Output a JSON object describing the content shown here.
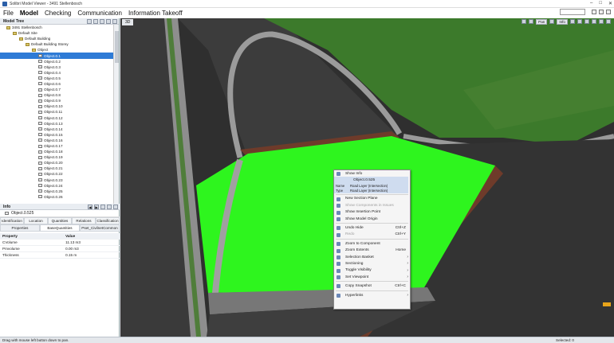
{
  "window": {
    "title": "Solibri Model Viewer - 3491 Stellenbosch",
    "minimize": "–",
    "maximize": "□",
    "close": "✕"
  },
  "menu": [
    "File",
    "Model",
    "Checking",
    "Communication",
    "Information Takeoff"
  ],
  "model_tree": {
    "title": "Model Tree",
    "nodes": [
      {
        "label": "3491 Stellenbosch",
        "indent": 1
      },
      {
        "label": "Default Site",
        "indent": 2
      },
      {
        "label": "Default Building",
        "indent": 3
      },
      {
        "label": "Default Building Storey",
        "indent": 4
      },
      {
        "label": "Object",
        "indent": 5
      },
      {
        "label": "Object.0.1",
        "indent": 6,
        "selected": true
      },
      {
        "label": "Object.0.2",
        "indent": 6
      },
      {
        "label": "Object.0.3",
        "indent": 6
      },
      {
        "label": "Object.0.4",
        "indent": 6
      },
      {
        "label": "Object.0.5",
        "indent": 6
      },
      {
        "label": "Object.0.6",
        "indent": 6
      },
      {
        "label": "Object.0.7",
        "indent": 6
      },
      {
        "label": "Object.0.8",
        "indent": 6
      },
      {
        "label": "Object.0.9",
        "indent": 6
      },
      {
        "label": "Object.0.10",
        "indent": 6
      },
      {
        "label": "Object.0.11",
        "indent": 6
      },
      {
        "label": "Object.0.12",
        "indent": 6
      },
      {
        "label": "Object.0.13",
        "indent": 6
      },
      {
        "label": "Object.0.14",
        "indent": 6
      },
      {
        "label": "Object.0.15",
        "indent": 6
      },
      {
        "label": "Object.0.16",
        "indent": 6
      },
      {
        "label": "Object.0.17",
        "indent": 6
      },
      {
        "label": "Object.0.18",
        "indent": 6
      },
      {
        "label": "Object.0.19",
        "indent": 6
      },
      {
        "label": "Object.0.20",
        "indent": 6
      },
      {
        "label": "Object.0.21",
        "indent": 6
      },
      {
        "label": "Object.0.22",
        "indent": 6
      },
      {
        "label": "Object.0.23",
        "indent": 6
      },
      {
        "label": "Object.0.24",
        "indent": 6
      },
      {
        "label": "Object.0.25",
        "indent": 6
      },
      {
        "label": "Object.0.26",
        "indent": 6
      }
    ]
  },
  "info": {
    "title": "Info",
    "object": "Object.0.525",
    "tabs_row1": [
      "Identification",
      "Location",
      "Quantities",
      "Relations",
      "Classification"
    ],
    "tabs_row2": [
      "Properties",
      "BaseQuantities",
      "Pset_CivilnetCommon"
    ],
    "columns": [
      "Property",
      "Value"
    ],
    "rows": [
      [
        "CVolume",
        "11.13 m3"
      ],
      [
        "Pmvolume",
        "0.00 m3"
      ],
      [
        "Thickness",
        "0.15 m"
      ]
    ]
  },
  "viewport": {
    "tab": "3D",
    "toolbar": {
      "pan": "Pan",
      "info": "Info"
    }
  },
  "context_menu": {
    "show_info": "Show Info",
    "sub_object": "Object.0.525",
    "sub_props": [
      [
        "Name",
        "Road Layer (Intersection)"
      ],
      [
        "Type",
        "Road Layer (Intersection)"
      ]
    ],
    "items1": [
      {
        "label": "New Section Plane"
      },
      {
        "label": "Show Components in Issues",
        "disabled": true
      },
      {
        "label": "Show Insertion Point"
      },
      {
        "label": "Show Model Origin"
      }
    ],
    "items2": [
      {
        "label": "Undo Hide",
        "shortcut": "Ctrl+Z"
      },
      {
        "label": "Redo",
        "shortcut": "Ctrl+Y",
        "disabled": true
      }
    ],
    "items3": [
      {
        "label": "Zoom to Component"
      },
      {
        "label": "Zoom Extents",
        "shortcut": "Home"
      },
      {
        "label": "Selection Basket",
        "submenu": true
      },
      {
        "label": "Sectioning",
        "submenu": true
      },
      {
        "label": "Toggle Visibility",
        "submenu": true
      },
      {
        "label": "Set Viewpoint",
        "submenu": true
      }
    ],
    "items4": [
      {
        "label": "Copy Snapshot",
        "shortcut": "Ctrl+C"
      }
    ],
    "items5": [
      {
        "label": "Hyperlinks",
        "submenu": true
      }
    ]
  },
  "status": {
    "left": "Drag with mouse left button down to pan.",
    "right": "Selected: 0"
  },
  "colors": {
    "grass": "#3c7a2b",
    "road": "#3a3a3a",
    "kerb": "#9a9a9a",
    "green_selected": "#2ef51e",
    "brown": "#6e3b2a",
    "accent": "#e8a41a"
  }
}
